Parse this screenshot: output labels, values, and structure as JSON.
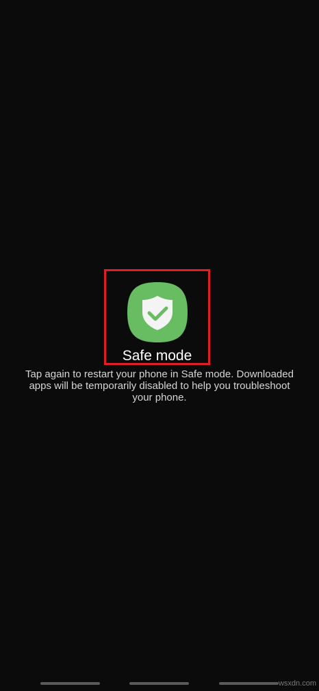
{
  "safe_mode": {
    "label": "Safe mode",
    "icon": "shield-check-icon",
    "description": "Tap again to restart your phone in Safe mode. Downloaded apps will be temporarily disabled to help you troubleshoot your phone."
  },
  "nav_bar": {
    "items": [
      "recent-apps-handle",
      "home-handle",
      "back-handle"
    ]
  },
  "watermark": {
    "text": "wsxdn.com"
  },
  "colors": {
    "background": "#0b0b0b",
    "icon_green": "#68bd63",
    "highlight_red": "#e11d26"
  }
}
